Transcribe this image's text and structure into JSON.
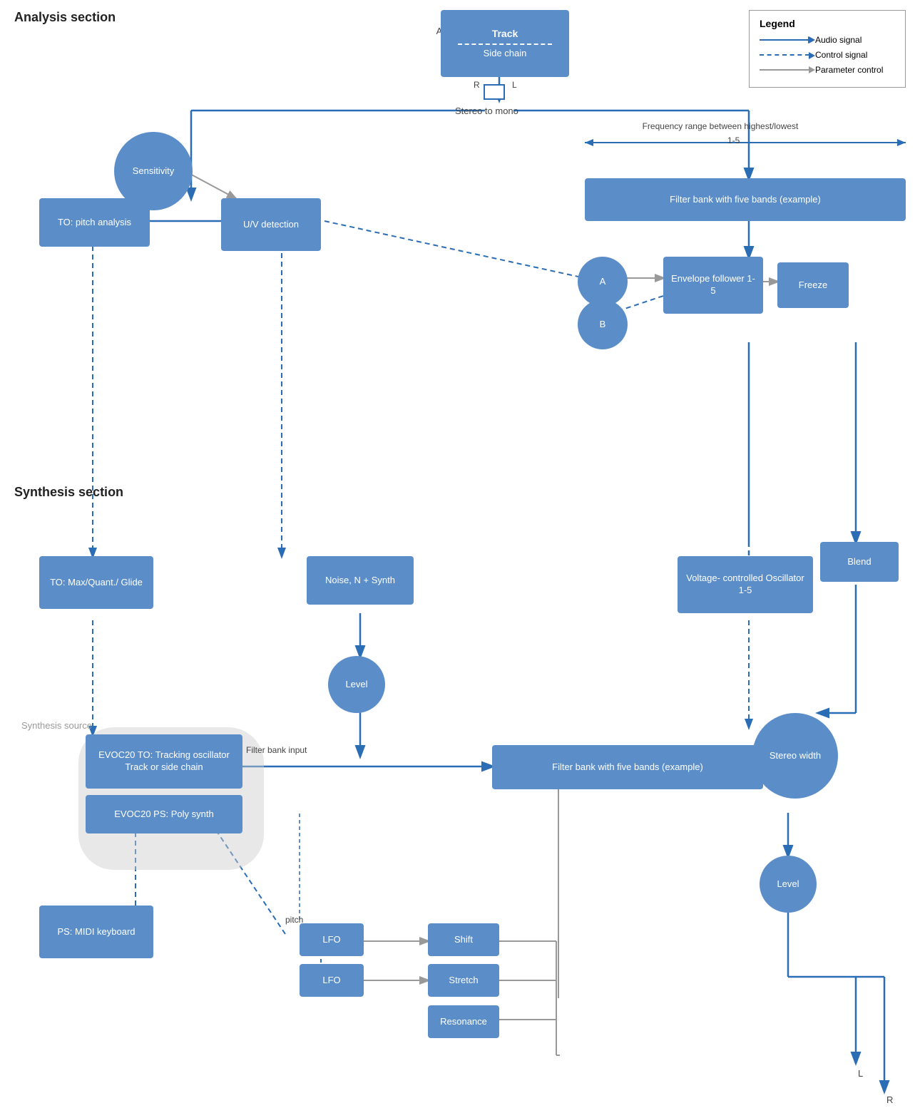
{
  "sections": {
    "analysis": "Analysis section",
    "synthesis": "Synthesis section"
  },
  "legend": {
    "title": "Legend",
    "items": [
      {
        "label": "Audio signal",
        "type": "solid"
      },
      {
        "label": "Control signal",
        "type": "dashed"
      },
      {
        "label": "Parameter control",
        "type": "gray"
      }
    ]
  },
  "labels": {
    "analysis_source": "Analysis\nsource",
    "track": "Track",
    "side_chain": "Side chain",
    "r": "R",
    "l": "L",
    "stereo_to_mono": "Stereo to mono",
    "frequency_range": "Frequency range between highest/lowest",
    "frequency_range_2": "1-5",
    "sensitivity": "Sensitivity",
    "uv_detection": "U/V\ndetection",
    "to_pitch": "TO:\npitch analysis",
    "filter_bank_top": "Filter bank with five bands\n(example)",
    "a": "A",
    "b": "B",
    "envelope_follower": "Envelope\nfollower\n1-5",
    "freeze": "Freeze",
    "to_max": "TO:\nMax/Quant./\nGlide",
    "noise": "Noise,\nN + Synth",
    "voltage": "Voltage-\ncontrolled\nOscillator 1-5",
    "blend": "Blend",
    "level_top": "Level",
    "synthesis_source": "Synthesis\nsource",
    "evoc20_to": "EVOC20 TO:\nTracking oscillator\nTrack or side chain",
    "evoc20_ps": "EVOC20 PS:\nPoly synth",
    "filter_bank_input": "Filter bank\ninput",
    "filter_bank_bottom": "Filter bank with five bands\n(example)",
    "stereo_width": "Stereo\nwidth",
    "level_bottom": "Level",
    "ps_midi": "PS:\nMIDI\nkeyboard",
    "pitch": "pitch",
    "lfo1": "LFO",
    "lfo2": "LFO",
    "shift": "Shift",
    "stretch": "Stretch",
    "resonance": "Resonance",
    "l_bottom": "L",
    "r_bottom": "R"
  }
}
